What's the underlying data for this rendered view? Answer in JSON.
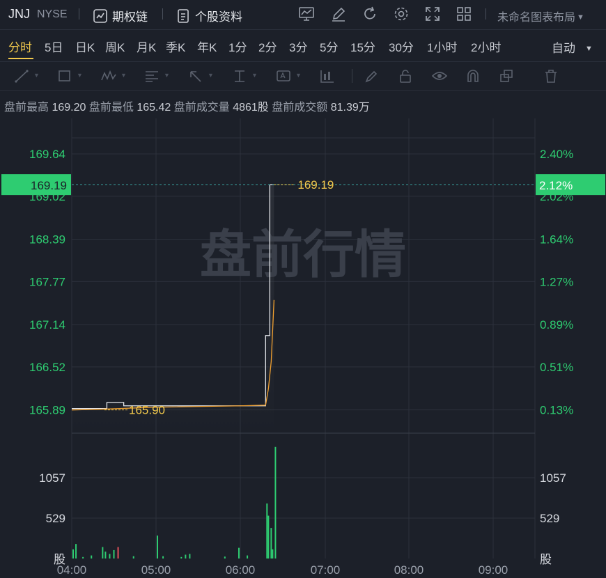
{
  "header": {
    "ticker": "JNJ",
    "exchange": "NYSE",
    "options_chain": "期权链",
    "stock_profile": "个股资料",
    "layout_name": "未命名图表布局"
  },
  "tabs": {
    "items": [
      "分时",
      "5日",
      "日K",
      "周K",
      "月K",
      "季K",
      "年K",
      "1分",
      "2分",
      "3分",
      "5分",
      "15分",
      "30分",
      "1小时",
      "2小时"
    ],
    "active": "分时",
    "mode": "自动"
  },
  "tools": [
    "line-tool-icon",
    "rect-tool-icon",
    "pattern-tool-icon",
    "fib-tool-icon",
    "arrow-tool-icon",
    "measure-tool-icon",
    "text-tool-icon",
    "indicator-tool-icon",
    "brush-tool-icon",
    "lock-icon",
    "eye-icon",
    "magnet-icon",
    "layers-icon",
    "trash-icon"
  ],
  "info": {
    "high_label": "盘前最高",
    "high": "169.20",
    "low_label": "盘前最低",
    "low": "165.42",
    "vol_label": "盘前成交量",
    "vol": "4861股",
    "amt_label": "盘前成交额",
    "amt": "81.39万"
  },
  "chart_data": {
    "type": "line",
    "watermark": "盘前行情",
    "price_axis": [
      "169.64",
      "169.02",
      "168.39",
      "167.77",
      "167.14",
      "166.52",
      "165.89"
    ],
    "pct_axis": [
      "2.40%",
      "2.02%",
      "1.64%",
      "1.27%",
      "0.89%",
      "0.51%",
      "0.13%"
    ],
    "last_price_label": "169.19",
    "last_pct_label": "2.12%",
    "avg_price_label": "165.90",
    "volume_axis": [
      "1057",
      "529"
    ],
    "volume_unit": "股",
    "time_axis": [
      "04:00",
      "05:00",
      "06:00",
      "07:00",
      "08:00",
      "09:00"
    ],
    "ylim": [
      165.55,
      170.15
    ],
    "price": {
      "x": [
        "04:00",
        "04:25",
        "04:25",
        "04:37",
        "04:37",
        "06:18",
        "06:18",
        "06:21",
        "06:21",
        "06:24"
      ],
      "values": [
        165.91,
        165.91,
        166.0,
        166.0,
        165.95,
        165.95,
        166.98,
        166.98,
        169.19,
        169.19
      ]
    },
    "avg": {
      "x": [
        "04:00",
        "04:20",
        "05:00",
        "06:00",
        "06:18",
        "06:20",
        "06:22",
        "06:24"
      ],
      "values": [
        165.89,
        165.9,
        165.93,
        165.95,
        165.96,
        166.2,
        166.6,
        167.5
      ]
    },
    "volume": [
      {
        "t": "04:01",
        "v": 120
      },
      {
        "t": "04:03",
        "v": 190
      },
      {
        "t": "04:08",
        "v": 20
      },
      {
        "t": "04:14",
        "v": 40
      },
      {
        "t": "04:22",
        "v": 150
      },
      {
        "t": "04:24",
        "v": 90
      },
      {
        "t": "04:27",
        "v": 60
      },
      {
        "t": "04:30",
        "v": 110
      },
      {
        "t": "04:33",
        "v": 150,
        "down": true
      },
      {
        "t": "04:44",
        "v": 30
      },
      {
        "t": "05:01",
        "v": 300
      },
      {
        "t": "05:05",
        "v": 30
      },
      {
        "t": "05:18",
        "v": 20
      },
      {
        "t": "05:21",
        "v": 50
      },
      {
        "t": "05:24",
        "v": 60
      },
      {
        "t": "05:49",
        "v": 25
      },
      {
        "t": "05:59",
        "v": 140
      },
      {
        "t": "06:05",
        "v": 40
      },
      {
        "t": "06:19",
        "v": 720
      },
      {
        "t": "06:20",
        "v": 560
      },
      {
        "t": "06:22",
        "v": 400
      },
      {
        "t": "06:23",
        "v": 120
      },
      {
        "t": "06:25",
        "v": 1460
      }
    ]
  },
  "colors": {
    "accent": "#f2c94c",
    "green": "#2ecc71",
    "red": "#e0505a",
    "bg": "#1c2029",
    "grid": "#2c313c"
  }
}
